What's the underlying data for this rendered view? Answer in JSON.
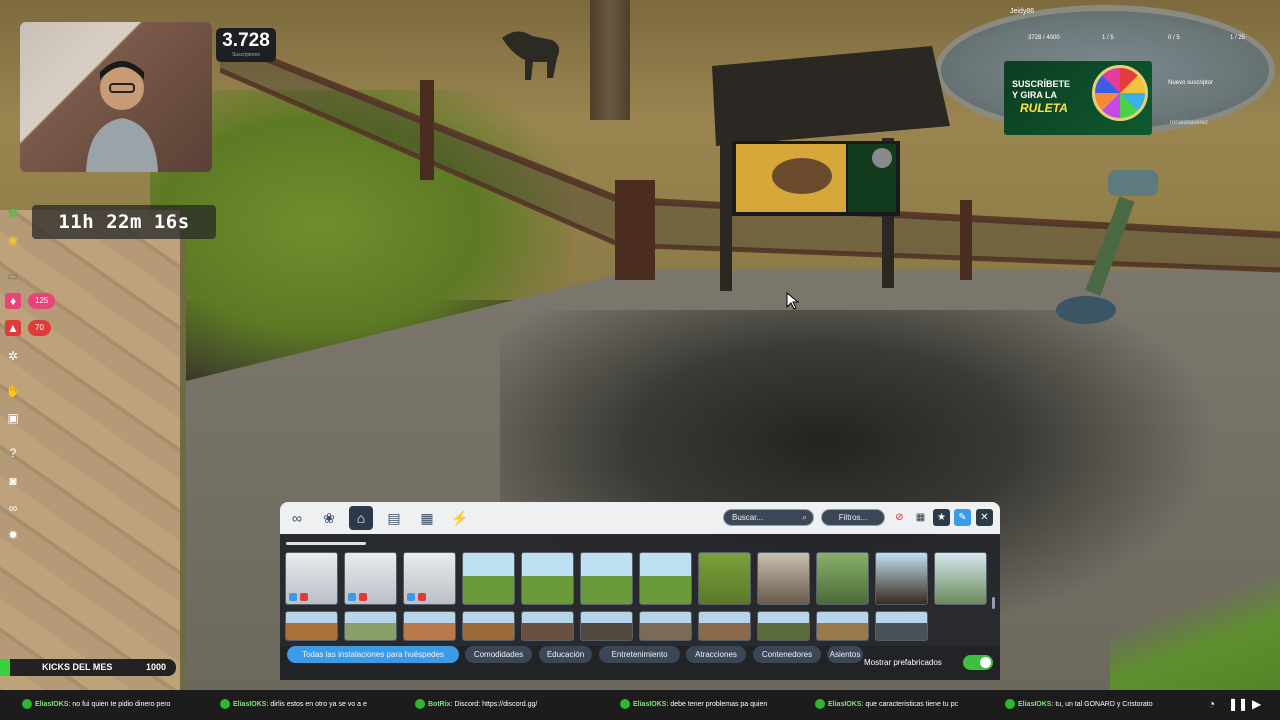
{
  "stream": {
    "subscriber_count": "3.728",
    "subscriber_label": "Suscriptores",
    "timer": "11h 22m 16s",
    "badge_125": "125",
    "badge_70": "70",
    "kicks_label": "KICKS DEL MES",
    "kicks_value": "1000"
  },
  "widget": {
    "user": "Jeidy86",
    "stat1": "3728 / 4000",
    "stat2": "1 / 5",
    "stat3": "0 / 5",
    "stat4": "1 / 25",
    "promo_line1": "SUSCRÍBETE",
    "promo_line2": "Y GIRA LA",
    "promo_line3": "RULETA",
    "new_sub_label": "Nuevo suscriptor",
    "new_sub_user": "ronaldnaverez"
  },
  "build_menu": {
    "search_placeholder": "Buscar...",
    "filters_label": "Filtros...",
    "categories": [
      {
        "name": "all-icon",
        "glyph": "∞",
        "active": false
      },
      {
        "name": "plants-icon",
        "glyph": "❀",
        "active": false
      },
      {
        "name": "facilities-icon",
        "glyph": "⌂",
        "active": true
      },
      {
        "name": "buildings-icon",
        "glyph": "▤",
        "active": false
      },
      {
        "name": "scenery-icon",
        "glyph": "▦",
        "active": false
      },
      {
        "name": "power-icon",
        "glyph": "⚡",
        "active": false
      }
    ],
    "chips": [
      "Todas las instalaciones para huéspedes",
      "Comodidades",
      "Educación",
      "Entretenimiento",
      "Atracciones",
      "Contenedores",
      "Asientos"
    ],
    "prefab_label": "Mostrar prefabricados",
    "prefab_toggle_on": true
  },
  "chat": [
    {
      "user": "EliasIOKS",
      "text": "no fui quien te pidio dinero pero"
    },
    {
      "user": "EliasIOKS",
      "text": "dirlis estos en otro ya se vo a e"
    },
    {
      "user": "BotRix",
      "text": "Discord: https://discord.gg/"
    },
    {
      "user": "EliasIOKS",
      "text": "debe tener problemas pa quien"
    },
    {
      "user": "EliasIOKS",
      "text": "que caracteristicas tiene tu pc"
    },
    {
      "user": "EliasIOKS",
      "text": "tu, un tal GONARD y Cristorato"
    }
  ],
  "colors": {
    "accent_blue": "#3b9be6",
    "toggle_green": "#3fbf3f",
    "alert_red": "#e03a3a",
    "pink": "#e8447a"
  }
}
